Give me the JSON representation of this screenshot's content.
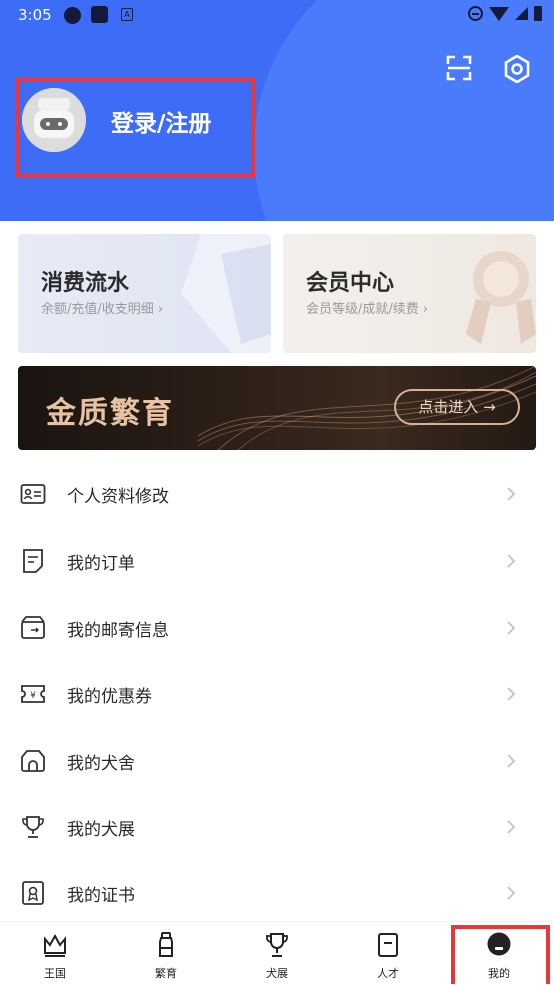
{
  "status_bar": {
    "time": "3:05"
  },
  "header": {
    "login_label": "登录/注册"
  },
  "cards": [
    {
      "title": "消费流水",
      "subtitle": "余额/充值/收支明细  ›"
    },
    {
      "title": "会员中心",
      "subtitle": "会员等级/成就/续费  ›"
    }
  ],
  "banner": {
    "title": "金质繁育",
    "button": "点击进入 →"
  },
  "menu": [
    {
      "label": "个人资料修改",
      "icon": "id-card-icon"
    },
    {
      "label": "我的订单",
      "icon": "order-icon"
    },
    {
      "label": "我的邮寄信息",
      "icon": "mail-box-icon"
    },
    {
      "label": "我的优惠券",
      "icon": "coupon-icon"
    },
    {
      "label": "我的犬舍",
      "icon": "kennel-icon"
    },
    {
      "label": "我的犬展",
      "icon": "trophy-icon"
    },
    {
      "label": "我的证书",
      "icon": "certificate-icon"
    }
  ],
  "tabs": [
    {
      "label": "王国",
      "icon": "crown-icon"
    },
    {
      "label": "繁育",
      "icon": "bottle-icon"
    },
    {
      "label": "犬展",
      "icon": "trophy-icon"
    },
    {
      "label": "人才",
      "icon": "document-icon"
    },
    {
      "label": "我的",
      "icon": "profile-icon"
    }
  ],
  "colors": {
    "header_blue": "#3d6cf7",
    "highlight_red": "#e8373c"
  }
}
